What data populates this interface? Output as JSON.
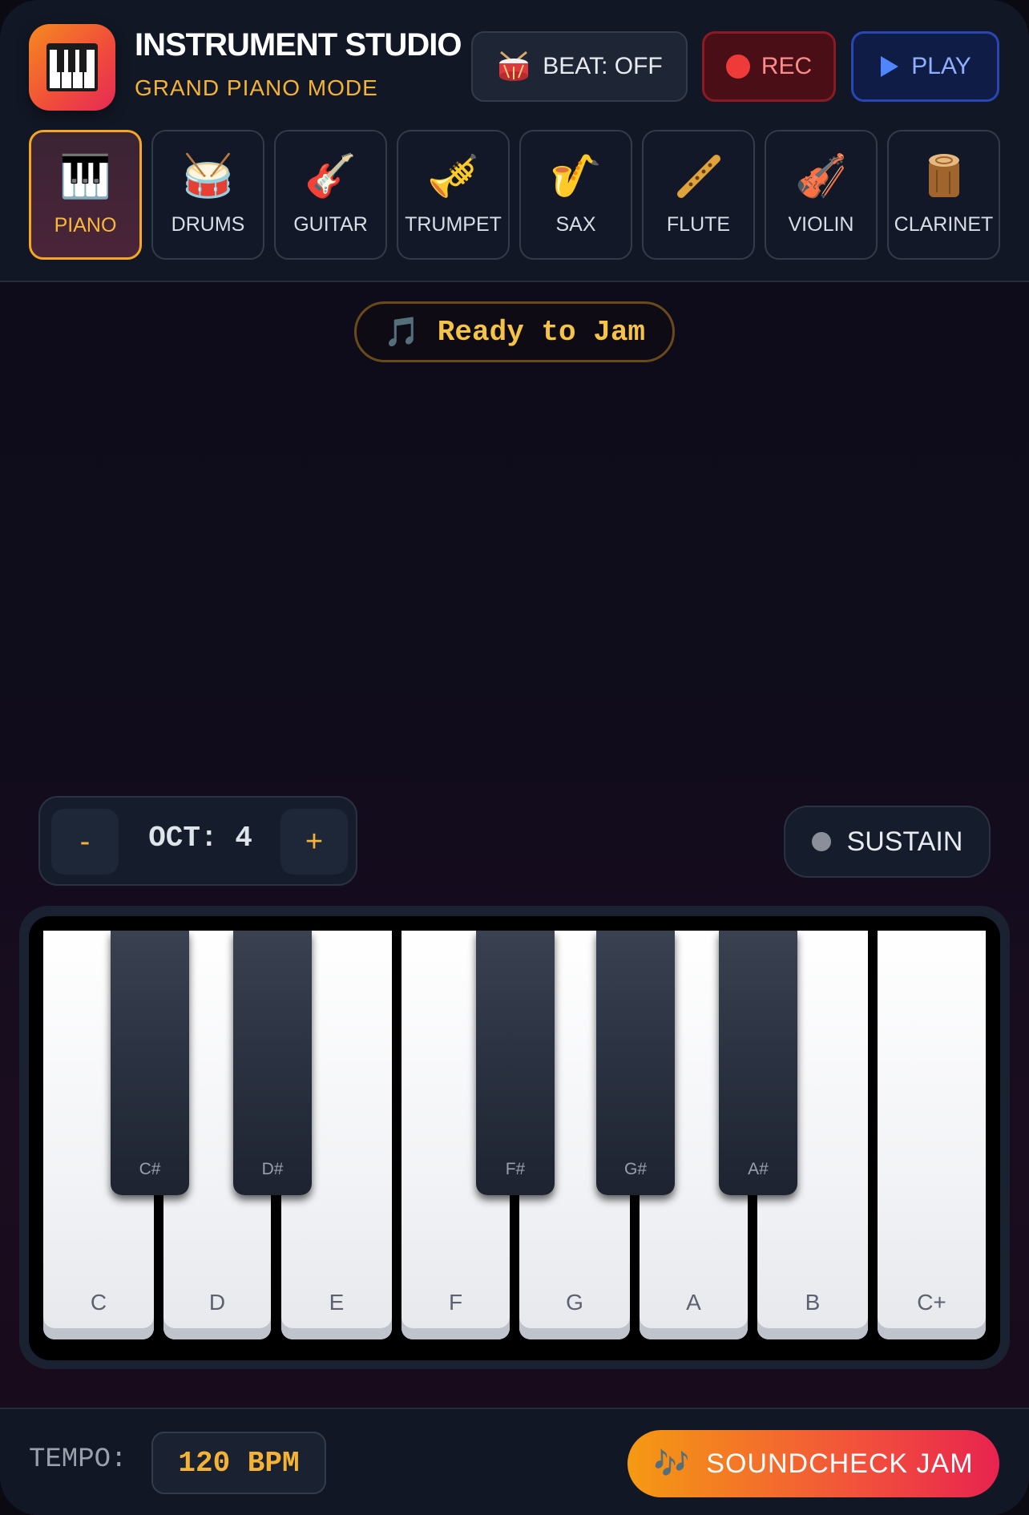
{
  "header": {
    "title": "INSTRUMENT STUDIO",
    "subtitle": "GRAND PIANO MODE",
    "logo_icon": "piano-icon",
    "beat_button": {
      "label": "BEAT: OFF",
      "icon": "drum-icon"
    },
    "rec_button": {
      "label": "REC",
      "icon": "record-dot-icon",
      "color": "#ef3a3a"
    },
    "play_button": {
      "label": "PLAY",
      "icon": "play-icon",
      "color": "#4f86ff"
    }
  },
  "instruments": [
    {
      "label": "PIANO",
      "emoji": "🎹",
      "icon": "piano-icon",
      "active": true
    },
    {
      "label": "DRUMS",
      "emoji": "🥁",
      "icon": "drum-icon",
      "active": false
    },
    {
      "label": "GUITAR",
      "emoji": "🎸",
      "icon": "guitar-icon",
      "active": false
    },
    {
      "label": "TRUMPET",
      "emoji": "🎺",
      "icon": "trumpet-icon",
      "active": false
    },
    {
      "label": "SAX",
      "emoji": "🎷",
      "icon": "saxophone-icon",
      "active": false
    },
    {
      "label": "FLUTE",
      "emoji": "🪈",
      "icon": "flute-icon",
      "active": false
    },
    {
      "label": "VIOLIN",
      "emoji": "🎻",
      "icon": "violin-icon",
      "active": false
    },
    {
      "label": "CLARINET",
      "emoji": "🪵",
      "icon": "wood-log-icon",
      "active": false
    }
  ],
  "status": {
    "icon": "music-note-icon",
    "text": "Ready to Jam"
  },
  "octave": {
    "minus_label": "-",
    "label": "OCT: 4",
    "plus_label": "+"
  },
  "sustain": {
    "label": "SUSTAIN",
    "enabled": false
  },
  "keyboard": {
    "white_keys": [
      "C",
      "D",
      "E",
      "F",
      "G",
      "A",
      "B",
      "C+"
    ],
    "black_keys": [
      "C#",
      "D#",
      "F#",
      "G#",
      "A#"
    ]
  },
  "footer": {
    "tempo_label": "TEMPO:",
    "tempo_value": "120 BPM",
    "jam_button": {
      "label": "SOUNDCHECK JAM",
      "icon": "music-notes-icon"
    }
  },
  "colors": {
    "accent": "#f5b335",
    "rec": "#ef3a3a",
    "play": "#4f86ff",
    "jam_gradient_start": "#f59a12",
    "jam_gradient_end": "#e8234f"
  }
}
